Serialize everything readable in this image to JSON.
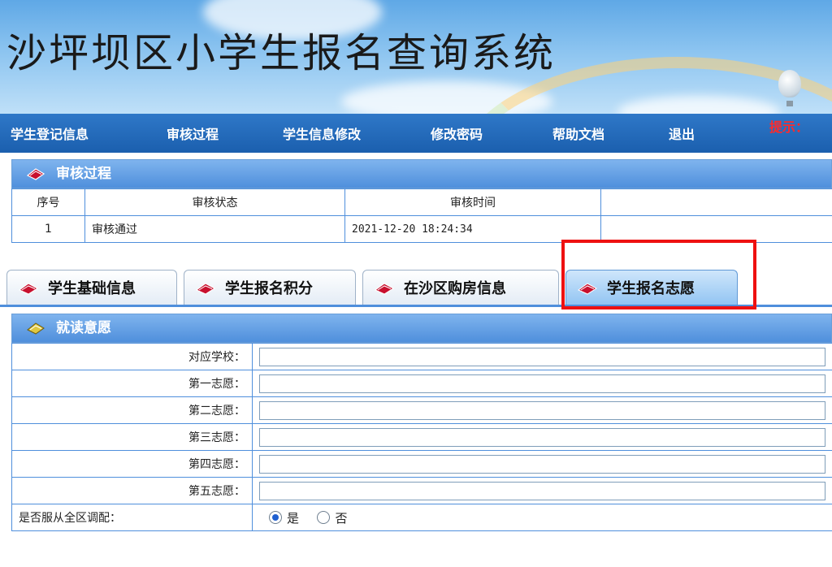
{
  "site": {
    "title": "沙坪坝区小学生报名查询系统"
  },
  "nav": {
    "items": [
      "学生登记信息",
      "审核过程",
      "学生信息修改",
      "修改密码",
      "帮助文档",
      "退出"
    ],
    "tip": "提示："
  },
  "review": {
    "title": "审核过程",
    "headers": [
      "序号",
      "审核状态",
      "审核时间"
    ],
    "rows": [
      {
        "seq": "1",
        "status": "审核通过",
        "time": "2021-12-20 18:24:34"
      }
    ]
  },
  "tabs": [
    "学生基础信息",
    "学生报名积分",
    "在沙区购房信息",
    "学生报名志愿"
  ],
  "active_tab": "学生报名志愿",
  "wish": {
    "title": "就读意愿",
    "fields": [
      {
        "label": "对应学校：",
        "value": ""
      },
      {
        "label": "第一志愿：",
        "value": ""
      },
      {
        "label": "第二志愿：",
        "value": ""
      },
      {
        "label": "第三志愿：",
        "value": ""
      },
      {
        "label": "第四志愿：",
        "value": ""
      },
      {
        "label": "第五志愿：",
        "value": ""
      }
    ],
    "obey_label": "是否服从全区调配：",
    "options": [
      "是",
      "否"
    ],
    "selected": "是"
  },
  "icons": {
    "panel": "book-icon",
    "tab": "book-icon",
    "balloon": "hot-air-balloon-icon"
  },
  "colors": {
    "nav_bg": "#1b5fae",
    "panel_head": "#4f8fdc",
    "highlight": "#ee1111",
    "tip": "#ff2a2a"
  }
}
